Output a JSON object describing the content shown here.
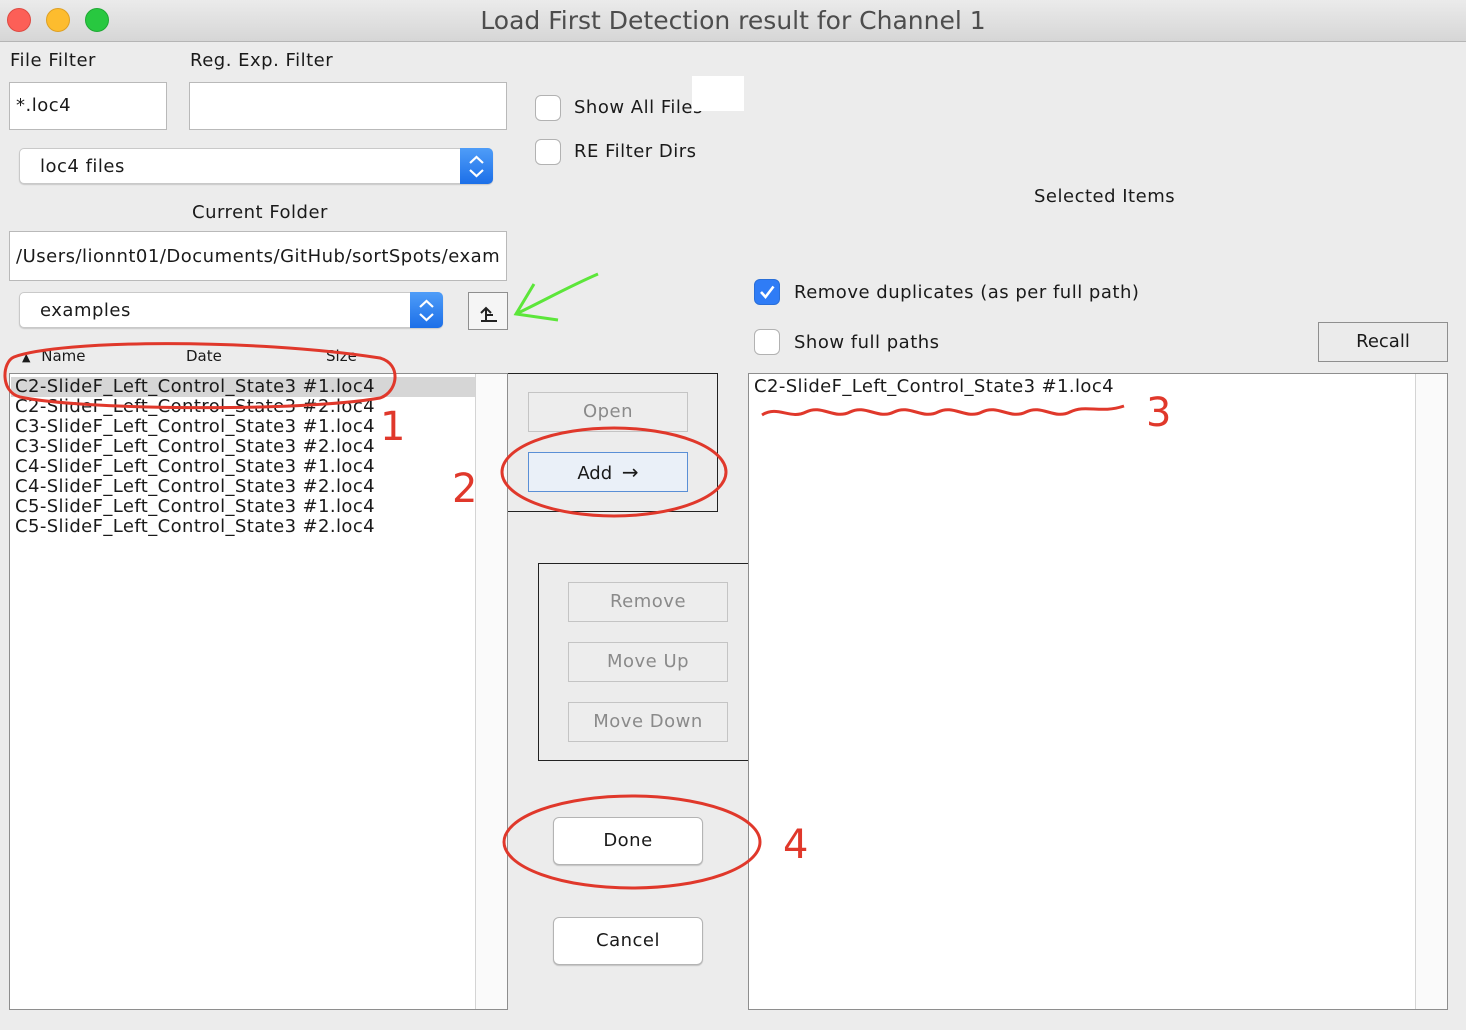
{
  "window": {
    "title": "Load First Detection result for Channel 1"
  },
  "filters": {
    "file_filter_label": "File Filter",
    "file_filter_value": "*.loc4",
    "regexp_label": "Reg. Exp. Filter",
    "regexp_value": "",
    "file_type_selected": "loc4 files",
    "show_all_files_label": "Show All Files",
    "re_filter_dirs_label": "RE Filter Dirs"
  },
  "folder": {
    "current_folder_label": "Current Folder",
    "path": "/Users/lionnt01/Documents/GitHub/sortSpots/exam",
    "selected_folder": "examples"
  },
  "file_list": {
    "columns": [
      "Name",
      "Date",
      "Size"
    ],
    "sort_indicator": "▲",
    "files": [
      "C2-SlideF_Left_Control_State3 #1.loc4",
      "C2-SlideF_Left_Control_State3 #2.loc4",
      "C3-SlideF_Left_Control_State3 #1.loc4",
      "C3-SlideF_Left_Control_State3 #2.loc4",
      "C4-SlideF_Left_Control_State3 #1.loc4",
      "C4-SlideF_Left_Control_State3 #2.loc4",
      "C5-SlideF_Left_Control_State3 #1.loc4",
      "C5-SlideF_Left_Control_State3 #2.loc4"
    ]
  },
  "actions": {
    "open": "Open",
    "add": "Add",
    "add_arrow": "→",
    "remove": "Remove",
    "move_up": "Move Up",
    "move_down": "Move Down",
    "done": "Done",
    "cancel": "Cancel"
  },
  "selected": {
    "header": "Selected Items",
    "remove_duplicates_label": "Remove duplicates (as per full path)",
    "remove_duplicates_checked": true,
    "show_full_paths_label": "Show full paths",
    "show_full_paths_checked": false,
    "recall": "Recall",
    "items": [
      "C2-SlideF_Left_Control_State3 #1.loc4"
    ]
  },
  "annotations": {
    "labels": [
      "1",
      "2",
      "3",
      "4"
    ],
    "red_color": "#e0382b",
    "green_color": "#5ce63a"
  }
}
